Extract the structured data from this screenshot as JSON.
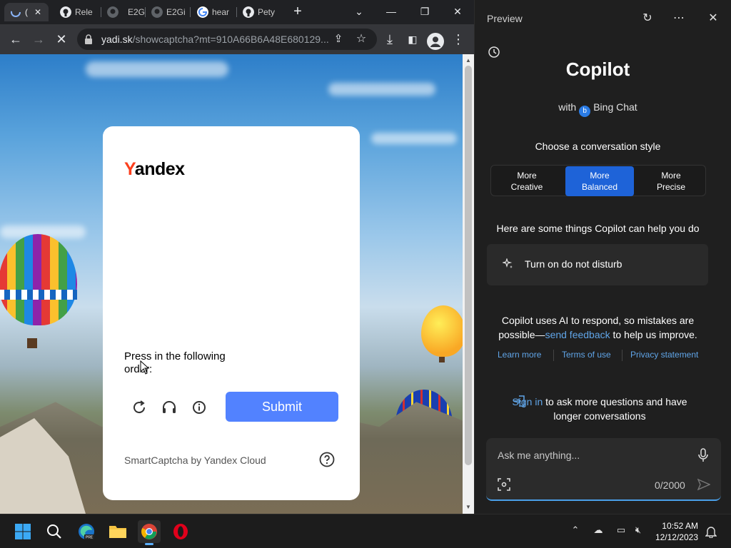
{
  "browser": {
    "tabs": [
      {
        "label": "(",
        "favicon": "loading"
      },
      {
        "label": "Rele",
        "favicon": "github"
      },
      {
        "label": "E2G",
        "favicon": "github"
      },
      {
        "label": "E2Gi",
        "favicon": "github"
      },
      {
        "label": "hear",
        "favicon": "google"
      },
      {
        "label": "Pety",
        "favicon": "github"
      }
    ],
    "url_host": "yadi.sk",
    "url_path": "/showcaptcha?mt=910A66B6A48E680129..."
  },
  "captcha": {
    "logo_text_first": "Y",
    "logo_text_rest": "andex",
    "instruction": "Press in the following order:",
    "submit_label": "Submit",
    "provider_label": "SmartCaptcha by Yandex Cloud"
  },
  "copilot": {
    "header_title": "Preview",
    "title": "Copilot",
    "subtitle_prefix": "with",
    "subtitle_brand": "Bing Chat",
    "style_label": "Choose a conversation style",
    "styles": [
      {
        "line1": "More",
        "line2": "Creative",
        "selected": false
      },
      {
        "line1": "More",
        "line2": "Balanced",
        "selected": true
      },
      {
        "line1": "More",
        "line2": "Precise",
        "selected": false
      }
    ],
    "help_title": "Here are some things Copilot can help you do",
    "suggestion": "Turn on do not disturb",
    "disclaimer_1": "Copilot uses AI to respond, so mistakes are possible—",
    "disclaimer_link": "send feedback",
    "disclaimer_2": " to help us improve.",
    "links": [
      "Learn more",
      "Terms of use",
      "Privacy statement"
    ],
    "signin_link": "Sign in",
    "signin_text": " to ask more questions and have longer conversations",
    "input_placeholder": "Ask me anything...",
    "char_count": "0/2000"
  },
  "taskbar": {
    "time": "10:52 AM",
    "date": "12/12/2023"
  },
  "colors": {
    "accent_blue": "#1e63d8",
    "submit_blue": "#5282ff",
    "yandex_red": "#fc3f1d",
    "link_blue": "#60a5e8"
  }
}
